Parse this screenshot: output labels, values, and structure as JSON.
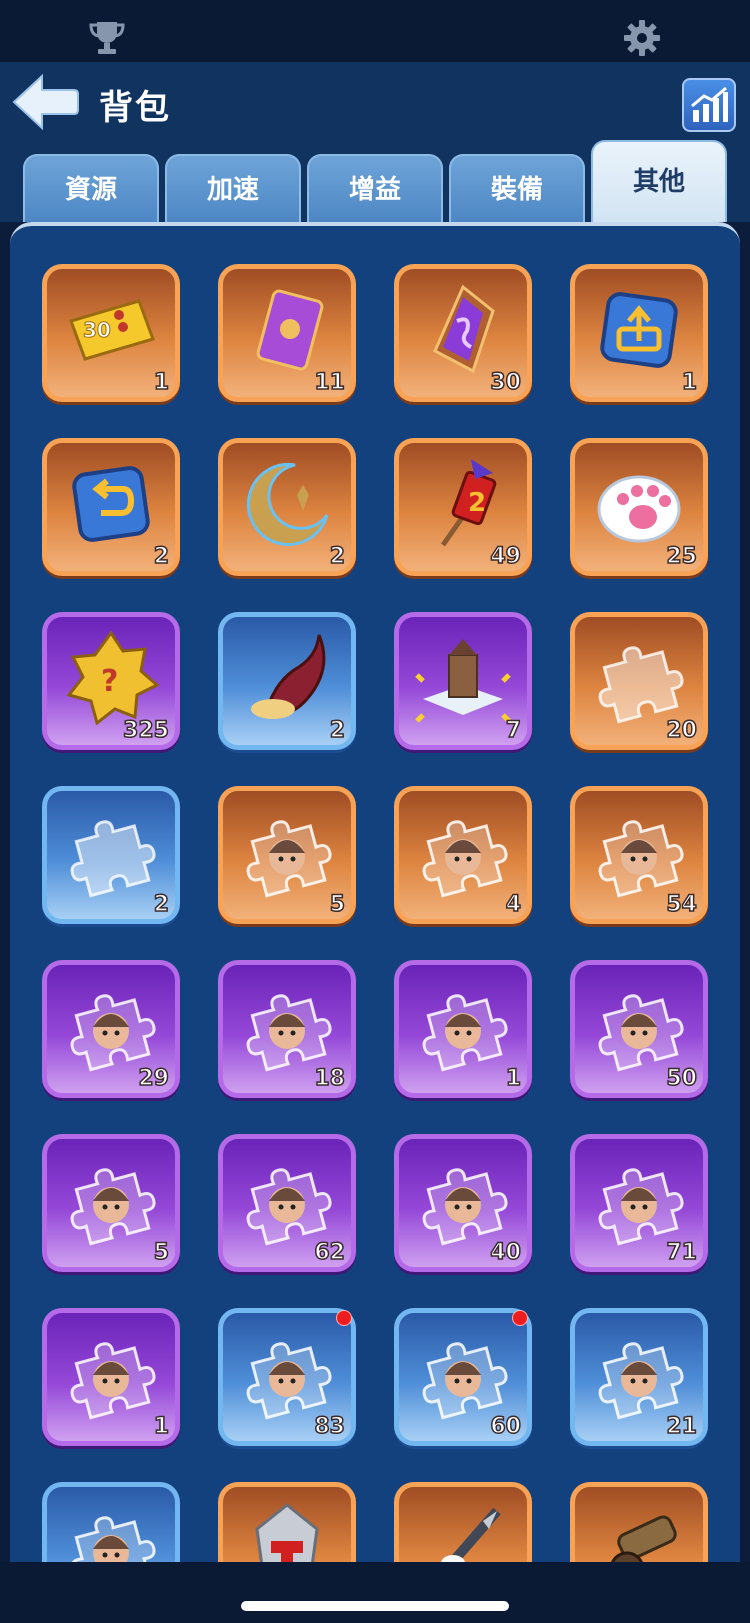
{
  "header": {
    "title": "背包"
  },
  "tabs": [
    {
      "label": "資源",
      "active": false
    },
    {
      "label": "加速",
      "active": false
    },
    {
      "label": "增益",
      "active": false
    },
    {
      "label": "裝備",
      "active": false
    },
    {
      "label": "其他",
      "active": true
    }
  ],
  "items": [
    {
      "icon": "30-ticket-icon",
      "tier": "orange",
      "count": "1"
    },
    {
      "icon": "card-icon",
      "tier": "orange",
      "count": "11"
    },
    {
      "icon": "purple-crystal-icon",
      "tier": "orange",
      "count": "30"
    },
    {
      "icon": "upload-tile-icon",
      "tier": "orange",
      "count": "1"
    },
    {
      "icon": "return-tile-icon",
      "tier": "orange",
      "count": "2"
    },
    {
      "icon": "crescent-moon-icon",
      "tier": "orange",
      "count": "2"
    },
    {
      "icon": "firework-rocket-icon",
      "tier": "orange",
      "count": "49"
    },
    {
      "icon": "paw-icon",
      "tier": "orange",
      "count": "25"
    },
    {
      "icon": "mystery-badge-icon",
      "tier": "purple",
      "count": "325"
    },
    {
      "icon": "horn-icon",
      "tier": "blue",
      "count": "2"
    },
    {
      "icon": "tower-relocate-icon",
      "tier": "purple",
      "count": "7"
    },
    {
      "icon": "puzzle-piece-icon",
      "tier": "orange",
      "count": "20"
    },
    {
      "icon": "puzzle-piece-icon",
      "tier": "blue",
      "count": "2"
    },
    {
      "icon": "hero-fragment-icon",
      "tier": "orange",
      "count": "5"
    },
    {
      "icon": "hero-fragment-icon",
      "tier": "orange",
      "count": "4"
    },
    {
      "icon": "hero-fragment-icon",
      "tier": "orange",
      "count": "54"
    },
    {
      "icon": "hero-fragment-icon",
      "tier": "purple",
      "count": "29"
    },
    {
      "icon": "hero-fragment-icon",
      "tier": "purple",
      "count": "18"
    },
    {
      "icon": "hero-fragment-icon",
      "tier": "purple",
      "count": "1"
    },
    {
      "icon": "hero-fragment-icon",
      "tier": "purple",
      "count": "50"
    },
    {
      "icon": "hero-fragment-icon",
      "tier": "purple",
      "count": "5"
    },
    {
      "icon": "hero-fragment-icon",
      "tier": "purple",
      "count": "62"
    },
    {
      "icon": "hero-fragment-icon",
      "tier": "purple",
      "count": "40"
    },
    {
      "icon": "hero-fragment-icon",
      "tier": "purple",
      "count": "71"
    },
    {
      "icon": "hero-fragment-icon",
      "tier": "purple",
      "count": "1"
    },
    {
      "icon": "hero-fragment-icon",
      "tier": "blue",
      "count": "83",
      "dot": true
    },
    {
      "icon": "hero-fragment-icon",
      "tier": "blue",
      "count": "60",
      "dot": true
    },
    {
      "icon": "hero-fragment-icon",
      "tier": "blue",
      "count": "21"
    },
    {
      "icon": "hero-fragment-icon",
      "tier": "blue",
      "count": ""
    },
    {
      "icon": "hammer-stone-icon",
      "tier": "orange",
      "count": ""
    },
    {
      "icon": "drill-icon",
      "tier": "orange",
      "count": ""
    },
    {
      "icon": "cannon-icon",
      "tier": "orange",
      "count": ""
    }
  ]
}
